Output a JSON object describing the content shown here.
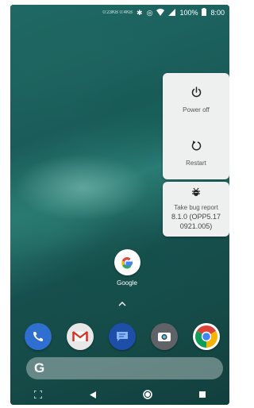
{
  "status_bar": {
    "small_text": "0:23KB 0:4KB",
    "battery": "100%",
    "time": "8:00",
    "icons": [
      "usb-icon",
      "data-saver-icon",
      "wifi-icon",
      "signal-icon",
      "battery-icon"
    ]
  },
  "power_menu": {
    "items": [
      {
        "icon": "power-icon",
        "label": "Power off"
      },
      {
        "icon": "restart-icon",
        "label": "Restart"
      }
    ],
    "bug_report": {
      "icon": "bug-icon",
      "label": "Take bug report",
      "version_line1": "8.1.0 (OPP5.17",
      "version_line2": "0921.005)"
    }
  },
  "home": {
    "google_app_label": "Google",
    "dock": [
      "phone-icon",
      "gmail-icon",
      "messages-icon",
      "camera-icon",
      "chrome-icon"
    ],
    "search_letter": "G"
  },
  "nav": [
    "screenshot-icon",
    "back-icon",
    "home-icon",
    "recents-icon"
  ]
}
